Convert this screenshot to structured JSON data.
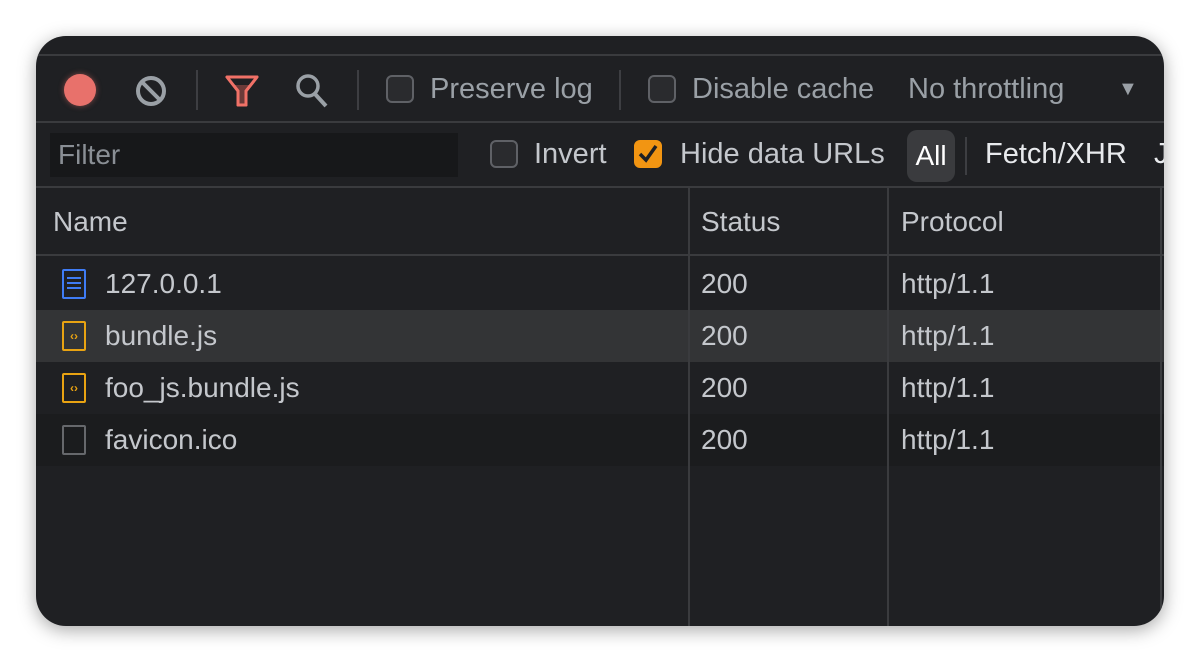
{
  "toolbar": {
    "record_icon": "record-icon",
    "clear_icon": "clear-icon",
    "filter_icon": "funnel-icon",
    "search_icon": "search-icon",
    "preserve_log": "Preserve log",
    "disable_cache": "Disable cache",
    "throttling": "No throttling",
    "record_color": "#e8716b",
    "filter_color": "#f07167"
  },
  "filter": {
    "placeholder": "Filter",
    "invert": "Invert",
    "hide_data_urls": "Hide data URLs",
    "hide_data_urls_checked": true,
    "types": [
      "All",
      "Fetch/XHR",
      "J"
    ],
    "accent": "#f29512"
  },
  "table": {
    "columns": [
      "Name",
      "Status",
      "Protocol"
    ],
    "rows": [
      {
        "name": "127.0.0.1",
        "status": "200",
        "protocol": "http/1.1",
        "icon": "document-icon",
        "icon_color": "#3f7cf5"
      },
      {
        "name": "bundle.js",
        "status": "200",
        "protocol": "http/1.1",
        "icon": "script-icon",
        "icon_color": "#e9a312"
      },
      {
        "name": "foo_js.bundle.js",
        "status": "200",
        "protocol": "http/1.1",
        "icon": "script-icon",
        "icon_color": "#e9a312"
      },
      {
        "name": "favicon.ico",
        "status": "200",
        "protocol": "http/1.1",
        "icon": "file-icon",
        "icon_color": "#66686c"
      }
    ]
  }
}
